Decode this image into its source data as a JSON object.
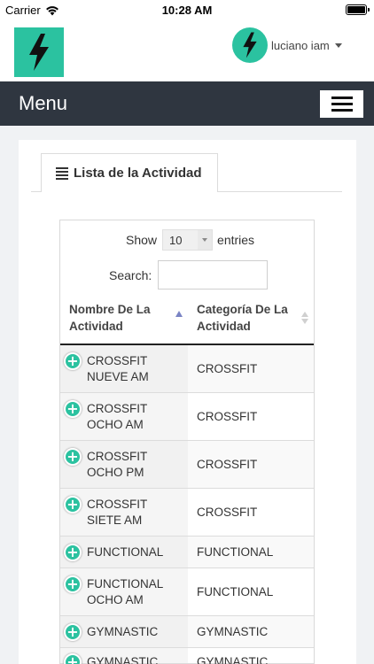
{
  "status_bar": {
    "carrier": "Carrier",
    "time": "10:28 AM"
  },
  "header": {
    "user_name": "luciano iam"
  },
  "menu": {
    "title": "Menu"
  },
  "tab": {
    "label": "Lista de la Actividad"
  },
  "table_controls": {
    "show_label": "Show",
    "entries_value": "10",
    "entries_label": "entries",
    "search_label": "Search:",
    "search_value": ""
  },
  "table": {
    "columns": [
      "Nombre De La Actividad",
      "Categoría De La Actividad"
    ],
    "rows": [
      {
        "name": "CROSSFIT NUEVE am",
        "category": "CROSSFIT"
      },
      {
        "name": "CROSSFIT OCHO am",
        "category": "CROSSFIT"
      },
      {
        "name": "CROSSFIT OCHO pm",
        "category": "CROSSFIT"
      },
      {
        "name": "CROSSFIT SIETE am",
        "category": "CROSSFIT"
      },
      {
        "name": "FUNCTIONAL",
        "category": "FUNCTIONAL"
      },
      {
        "name": "FUNCTIONAL OCHO am",
        "category": "FUNCTIONAL"
      },
      {
        "name": "GYMNASTIC",
        "category": "GYMNASTIC"
      },
      {
        "name": "GYMNASTIC",
        "category": "GYMNASTIC"
      }
    ]
  },
  "colors": {
    "accent": "#2bc2a0",
    "menu_bar": "#2f3640",
    "sort_active": "#7a84c4"
  },
  "icons": {
    "logo": "lightning-bolt-icon",
    "row_expand": "plus-circle-icon",
    "menu": "hamburger-icon"
  }
}
